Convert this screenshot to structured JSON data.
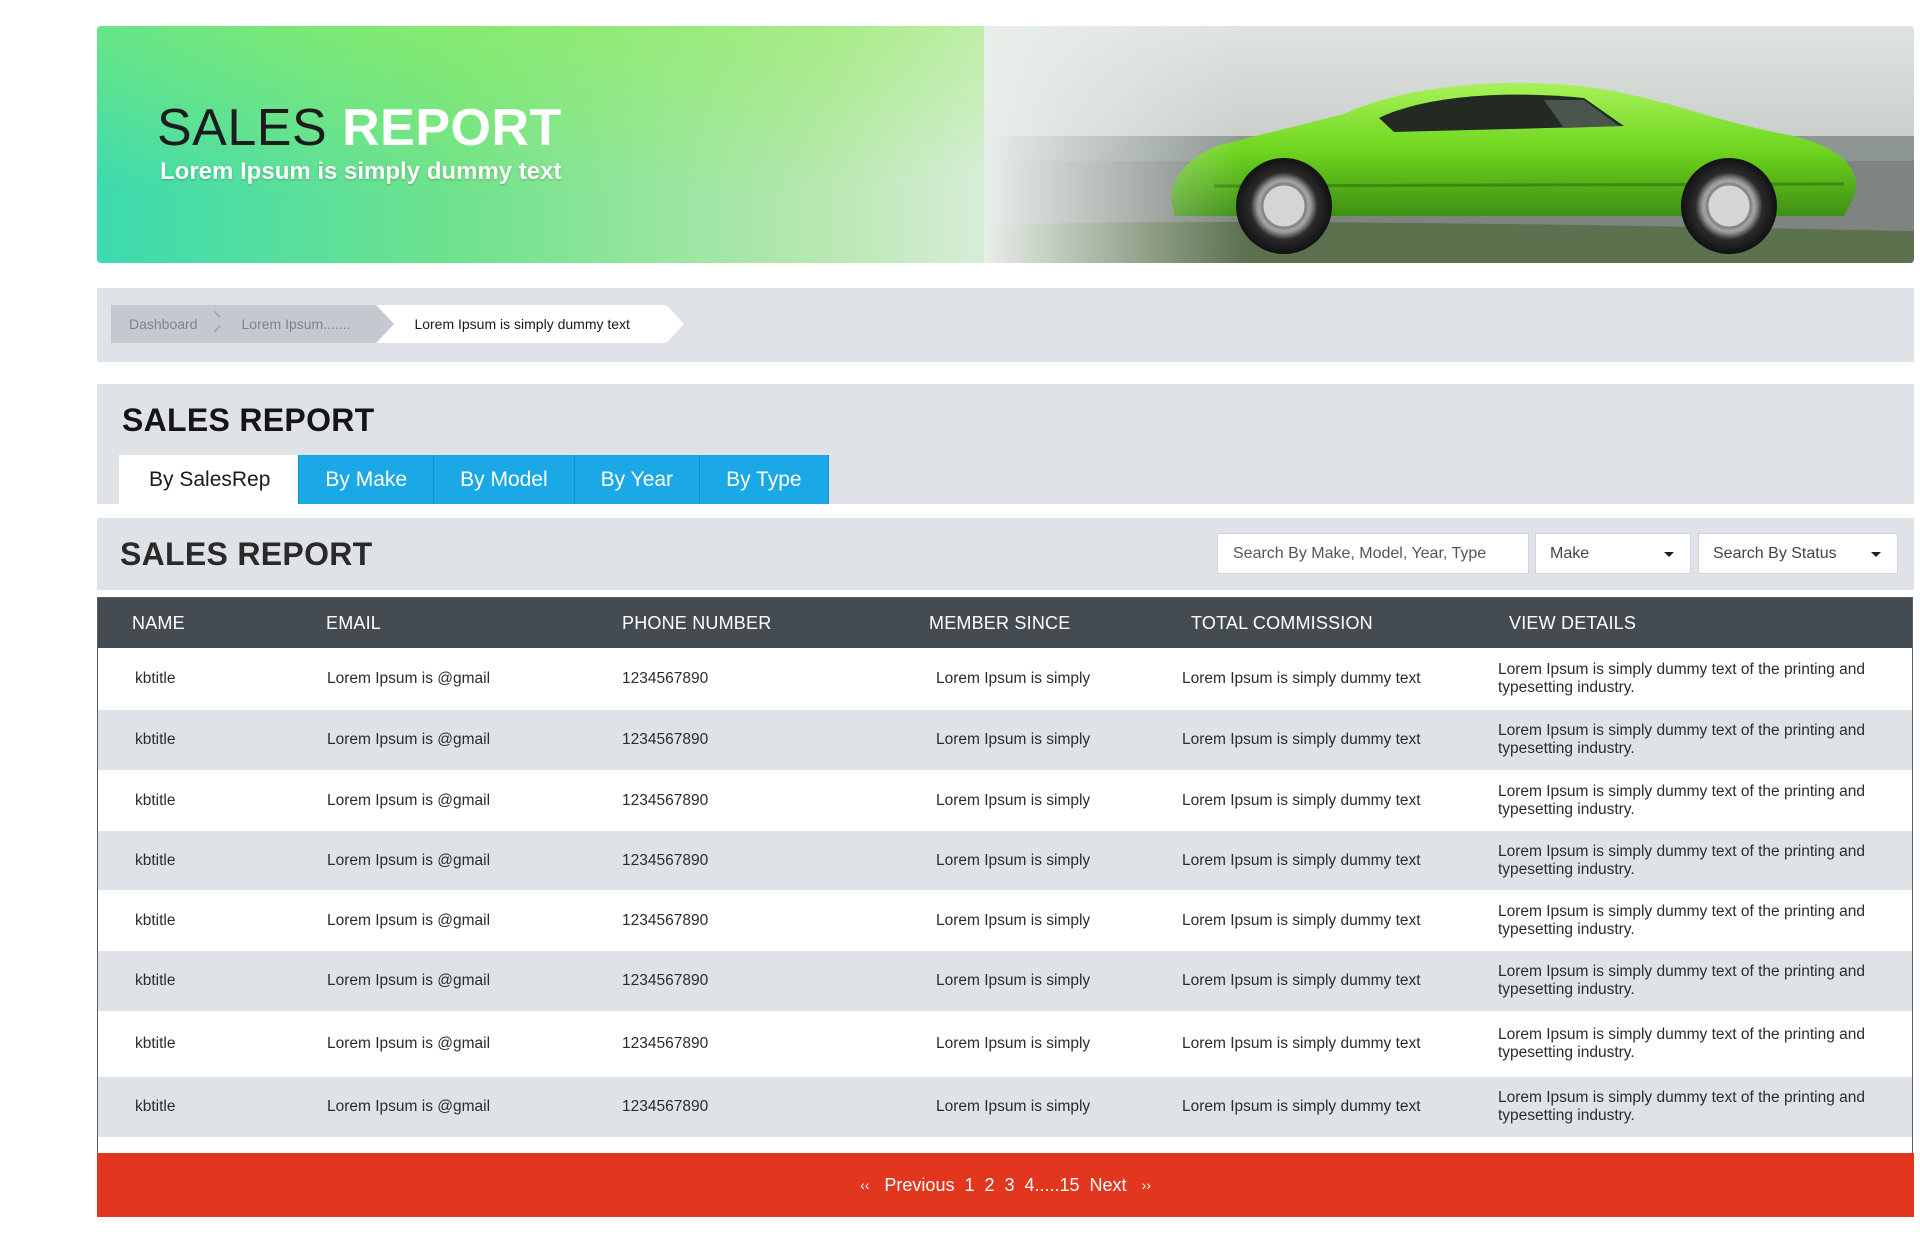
{
  "hero": {
    "title_light": "SALES ",
    "title_bold": "REPORT",
    "subtitle": "Lorem Ipsum is simply dummy text"
  },
  "breadcrumb": {
    "items": [
      "Dashboard",
      "Lorem Ipsum.......",
      "Lorem Ipsum is simply dummy text"
    ]
  },
  "tabs_section": {
    "title": "SALES REPORT",
    "tabs": [
      "By SalesRep",
      "By Make",
      "By Model",
      "By Year",
      "By Type"
    ],
    "active_tab": "By SalesRep"
  },
  "filters": {
    "title": "SALES REPORT",
    "search_placeholder": "Search By Make, Model, Year, Type",
    "make_select": "Make",
    "status_select": "Search By Status"
  },
  "table": {
    "headers": [
      "NAME",
      "EMAIL",
      "PHONE NUMBER",
      "MEMBER SINCE",
      "TOTAL COMMISSION",
      "VIEW DETAILS"
    ],
    "rows": [
      {
        "name": "kbtitle",
        "email": "Lorem Ipsum is @gmail",
        "phone": "1234567890",
        "member": "Lorem Ipsum is simply",
        "commission": "Lorem Ipsum is simply dummy text",
        "details": "Lorem Ipsum is simply dummy text of the printing and typesetting industry."
      },
      {
        "name": "kbtitle",
        "email": "Lorem Ipsum is @gmail",
        "phone": "1234567890",
        "member": "Lorem Ipsum is simply",
        "commission": "Lorem Ipsum is simply dummy text",
        "details": "Lorem Ipsum is simply dummy text of the printing and typesetting industry."
      },
      {
        "name": "kbtitle",
        "email": "Lorem Ipsum is @gmail",
        "phone": "1234567890",
        "member": "Lorem Ipsum is simply",
        "commission": "Lorem Ipsum is simply dummy text",
        "details": "Lorem Ipsum is simply dummy text of the printing and typesetting industry."
      },
      {
        "name": "kbtitle",
        "email": "Lorem Ipsum is @gmail",
        "phone": "1234567890",
        "member": "Lorem Ipsum is simply",
        "commission": "Lorem Ipsum is simply dummy text",
        "details": "Lorem Ipsum is simply dummy text of the printing and typesetting industry."
      },
      {
        "name": "kbtitle",
        "email": "Lorem Ipsum is @gmail",
        "phone": "1234567890",
        "member": "Lorem Ipsum is simply",
        "commission": "Lorem Ipsum is simply dummy text",
        "details": "Lorem Ipsum is simply dummy text of the printing and typesetting industry."
      },
      {
        "name": "kbtitle",
        "email": "Lorem Ipsum is @gmail",
        "phone": "1234567890",
        "member": "Lorem Ipsum is simply",
        "commission": "Lorem Ipsum is simply dummy text",
        "details": "Lorem Ipsum is simply dummy text of the printing and typesetting industry."
      },
      {
        "name": "kbtitle",
        "email": "Lorem Ipsum is @gmail",
        "phone": "1234567890",
        "member": "Lorem Ipsum is simply",
        "commission": "Lorem Ipsum is simply dummy text",
        "details": "Lorem Ipsum is simply dummy text of the printing and typesetting industry."
      },
      {
        "name": "kbtitle",
        "email": "Lorem Ipsum is @gmail",
        "phone": "1234567890",
        "member": "Lorem Ipsum is simply",
        "commission": "Lorem Ipsum is simply dummy text",
        "details": "Lorem Ipsum is simply dummy text of the printing and typesetting industry."
      }
    ]
  },
  "pagination": {
    "prev_arrow": "‹‹",
    "previous": "Previous",
    "pages": [
      "1",
      "2",
      "3",
      "4.....15"
    ],
    "next": "Next",
    "next_arrow": "››"
  },
  "colors": {
    "tab_blue": "#1aa8e6",
    "table_header": "#454c51",
    "pagination_red": "#e3361f",
    "panel_gray": "#dfe3e7",
    "car_green": "#7ed321"
  }
}
